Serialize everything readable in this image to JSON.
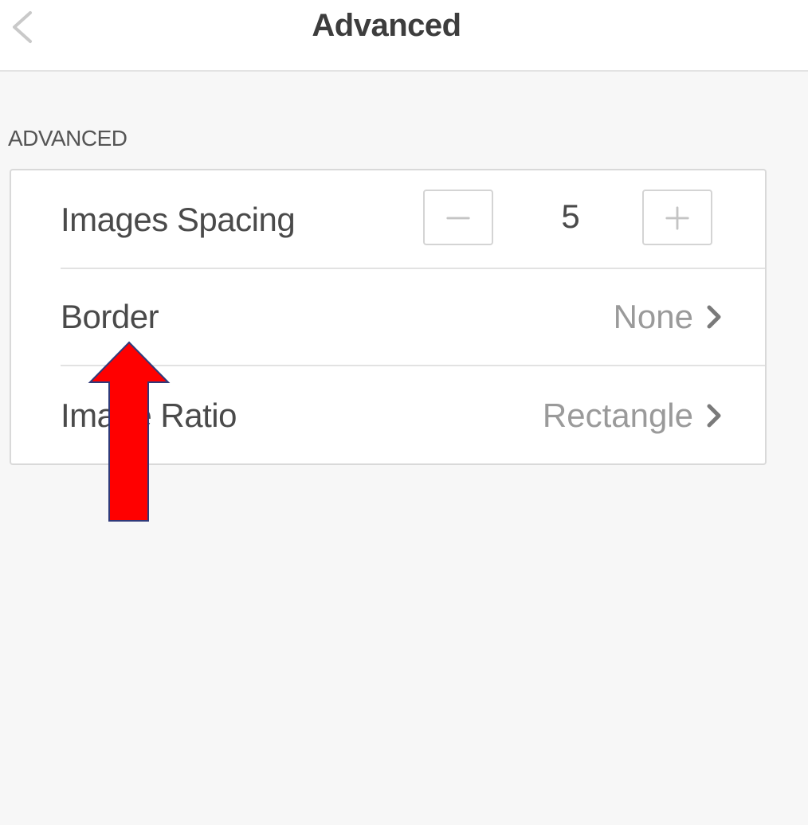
{
  "header": {
    "title": "Advanced",
    "back_icon": "chevron-left-icon"
  },
  "section": {
    "label": "ADVANCED"
  },
  "settings": {
    "images_spacing": {
      "label": "Images Spacing",
      "value": "5",
      "decrement_icon": "minus-icon",
      "increment_icon": "plus-icon"
    },
    "border": {
      "label": "Border",
      "value": "None",
      "icon": "chevron-right-icon"
    },
    "image_ratio": {
      "label": "Image Ratio",
      "value": "Rectangle",
      "icon": "chevron-right-icon"
    }
  },
  "annotation": {
    "type": "arrow-up",
    "color": "#ff0000",
    "outline_color": "#2f3a7a"
  },
  "colors": {
    "background": "#f7f7f7",
    "card": "#ffffff",
    "text": "#4a4a4a",
    "muted": "#9a9a9a"
  }
}
